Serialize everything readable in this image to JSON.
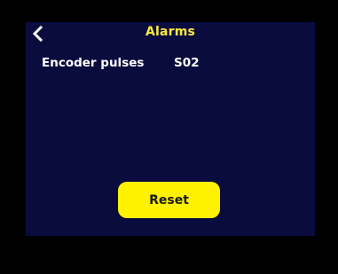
{
  "header": {
    "title": "Alarms",
    "back_icon": "chevron-left-icon"
  },
  "alarms": [
    {
      "label": "Encoder pulses",
      "code": "S02"
    }
  ],
  "actions": {
    "reset_label": "Reset"
  },
  "colors": {
    "screen_background": "#0a0c3e",
    "bezel": "#000000",
    "title_accent": "#ffeb3b",
    "button_background": "#fff200",
    "button_text": "#1a1a1a",
    "text_primary": "#ffffff"
  }
}
